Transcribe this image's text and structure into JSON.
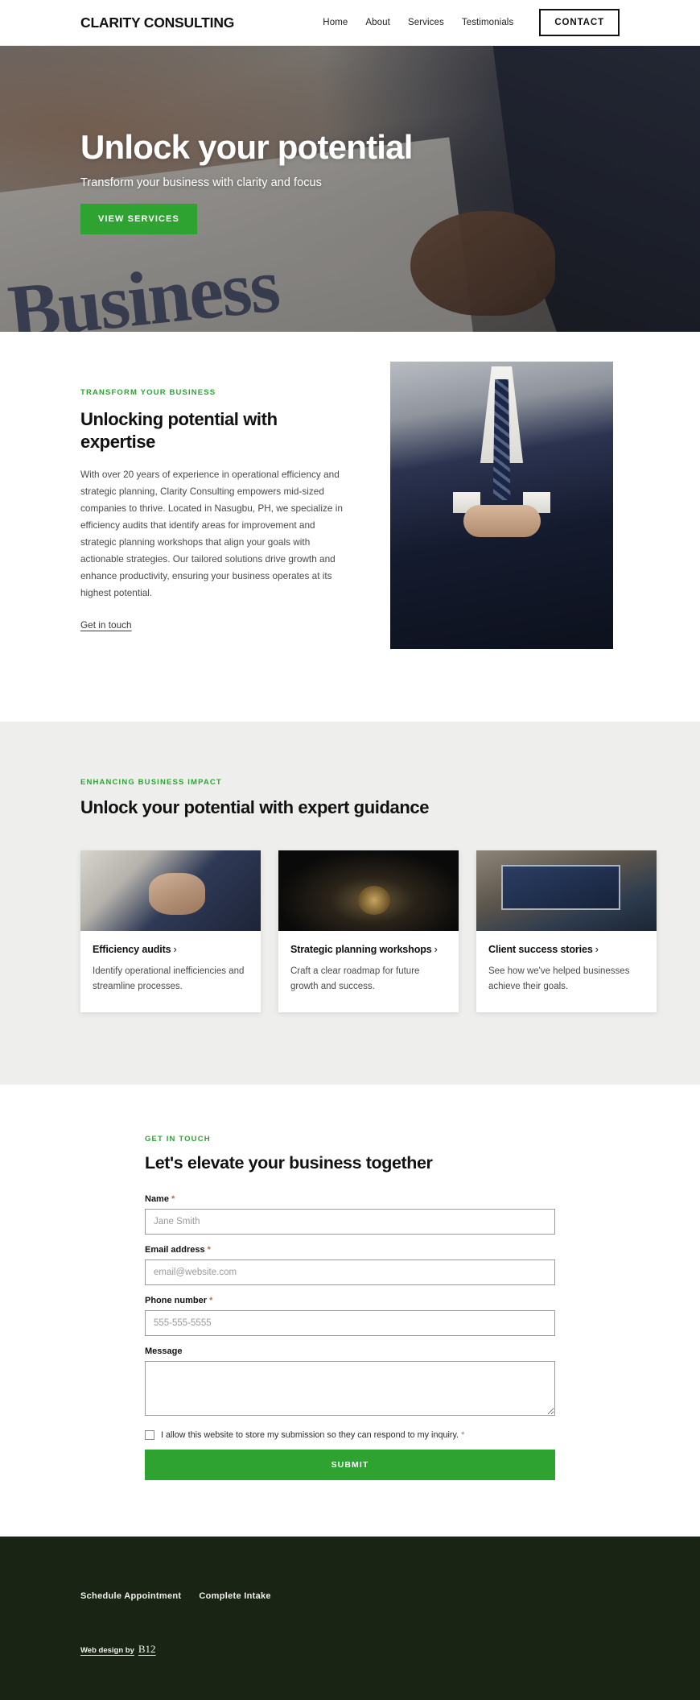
{
  "header": {
    "brand": "CLARITY CONSULTING",
    "nav": [
      {
        "label": "Home"
      },
      {
        "label": "About"
      },
      {
        "label": "Services"
      },
      {
        "label": "Testimonials"
      }
    ],
    "cta": "CONTACT"
  },
  "hero": {
    "title": "Unlock your potential",
    "subtitle": "Transform your business with clarity and focus",
    "button": "VIEW SERVICES",
    "background_word": "Business"
  },
  "about": {
    "eyebrow": "TRANSFORM YOUR BUSINESS",
    "heading": "Unlocking potential with expertise",
    "body": "With over 20 years of experience in operational efficiency and strategic planning, Clarity Consulting empowers mid-sized companies to thrive. Located in Nasugbu, PH, we specialize in efficiency audits that identify areas for improvement and strategic planning workshops that align your goals with actionable strategies. Our tailored solutions drive growth and enhance productivity, ensuring your business operates at its highest potential.",
    "link": "Get in touch"
  },
  "services": {
    "eyebrow": "ENHANCING BUSINESS IMPACT",
    "heading": "Unlock your potential with expert guidance",
    "cards": [
      {
        "title": "Efficiency audits",
        "chevron": "›",
        "text": "Identify operational inefficiencies and streamline processes.",
        "image": "handshake-photo"
      },
      {
        "title": "Strategic planning workshops",
        "chevron": "›",
        "text": "Craft a clear roadmap for future growth and success.",
        "image": "dark-coins-photo"
      },
      {
        "title": "Client success stories",
        "chevron": "›",
        "text": "See how we've helped businesses achieve their goals.",
        "image": "laptop-dashboard-photo"
      }
    ]
  },
  "contact": {
    "eyebrow": "GET IN TOUCH",
    "heading": "Let's elevate your business together",
    "fields": {
      "name": {
        "label": "Name",
        "required": "*",
        "placeholder": "Jane Smith",
        "value": ""
      },
      "email": {
        "label": "Email address",
        "required": "*",
        "placeholder": "email@website.com",
        "value": ""
      },
      "phone": {
        "label": "Phone number",
        "required": "*",
        "placeholder": "555-555-5555",
        "value": ""
      },
      "message": {
        "label": "Message",
        "placeholder": "",
        "value": ""
      }
    },
    "consent": {
      "text": "I allow this website to store my submission so they can respond to my inquiry.",
      "required": "*",
      "checked": false
    },
    "submit": "SUBMIT"
  },
  "footer": {
    "links": [
      {
        "label": "Schedule Appointment"
      },
      {
        "label": "Complete Intake"
      }
    ],
    "credit_prefix": "Web design by",
    "credit_brand": "B12"
  },
  "colors": {
    "accent_green": "#2fa332",
    "eyebrow_green": "#2aa534",
    "footer_dark": "#192415",
    "services_bg": "#eeefed",
    "required_asterisk": "#b5705a"
  }
}
